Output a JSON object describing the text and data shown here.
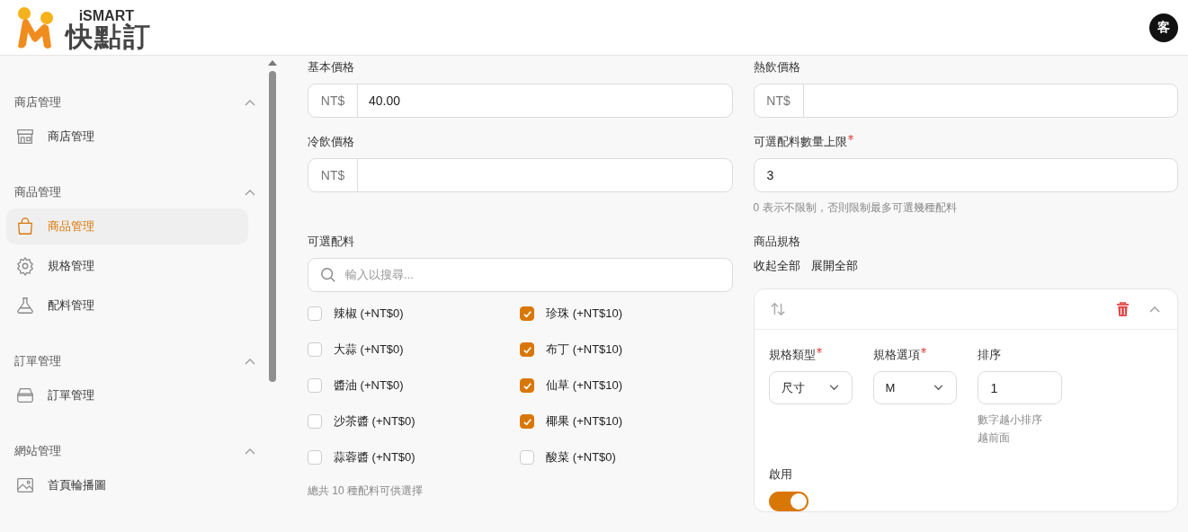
{
  "header": {
    "brand_small": "iSMART",
    "brand": "快點訂",
    "avatar": "客"
  },
  "sidebar": {
    "sections": [
      {
        "title": "商店管理",
        "expanded": true,
        "items": [
          {
            "label": "商店管理",
            "kind": "store",
            "selected": false
          }
        ]
      },
      {
        "title": "商品管理",
        "expanded": true,
        "items": [
          {
            "label": "商品管理",
            "kind": "bag",
            "selected": true
          },
          {
            "label": "規格管理",
            "kind": "gear",
            "selected": false
          },
          {
            "label": "配料管理",
            "kind": "flask",
            "selected": false
          }
        ]
      },
      {
        "title": "訂單管理",
        "expanded": true,
        "items": [
          {
            "label": "訂單管理",
            "kind": "tray",
            "selected": false
          }
        ]
      },
      {
        "title": "網站管理",
        "expanded": true,
        "items": [
          {
            "label": "首頁輪播圖",
            "kind": "image",
            "selected": false
          }
        ]
      }
    ]
  },
  "fields": [
    {
      "kind": "prefixed",
      "label": "基本價格",
      "required": false,
      "prefix": "NT$",
      "value": "40.00"
    },
    {
      "kind": "prefixed",
      "label": "熱飲價格",
      "required": false,
      "prefix": "NT$"
    },
    {
      "kind": "prefixed",
      "label": "冷飲價格",
      "required": false,
      "prefix": "NT$"
    },
    {
      "kind": "plain",
      "label": "可選配料數量上限",
      "required": true,
      "value": "3",
      "hint": "0 表示不限制，否則限制最多可選幾種配料"
    }
  ],
  "toppings": {
    "label": "可選配料",
    "search_placeholder": "輸入以搜尋...",
    "options": [
      {
        "label": "辣椒 (+NT$0)",
        "checked": false
      },
      {
        "label": "大蒜 (+NT$0)",
        "checked": false
      },
      {
        "label": "醬油 (+NT$0)",
        "checked": false
      },
      {
        "label": "沙茶醬 (+NT$0)",
        "checked": false
      },
      {
        "label": "蒜蓉醬 (+NT$0)",
        "checked": false
      },
      {
        "label": "珍珠 (+NT$10)",
        "checked": true
      },
      {
        "label": "布丁 (+NT$10)",
        "checked": true
      },
      {
        "label": "仙草 (+NT$10)",
        "checked": true
      },
      {
        "label": "椰果 (+NT$10)",
        "checked": true
      },
      {
        "label": "酸菜 (+NT$0)",
        "checked": false
      }
    ],
    "summary": "總共 10 種配料可供選擇"
  },
  "specs": {
    "label": "商品規格",
    "actions": [
      "收起全部",
      "展開全部"
    ],
    "cards": [
      {
        "expanded": true,
        "fields": [
          {
            "kind": "select",
            "label": "規格類型",
            "required": true,
            "value": "尺寸"
          },
          {
            "kind": "select",
            "label": "規格選項",
            "required": true,
            "value": "M"
          },
          {
            "kind": "number",
            "label": "排序",
            "required": false,
            "value": "1",
            "hint": "數字越小排序越前面"
          }
        ],
        "enabled_label": "啟用",
        "enabled": true
      }
    ]
  }
}
